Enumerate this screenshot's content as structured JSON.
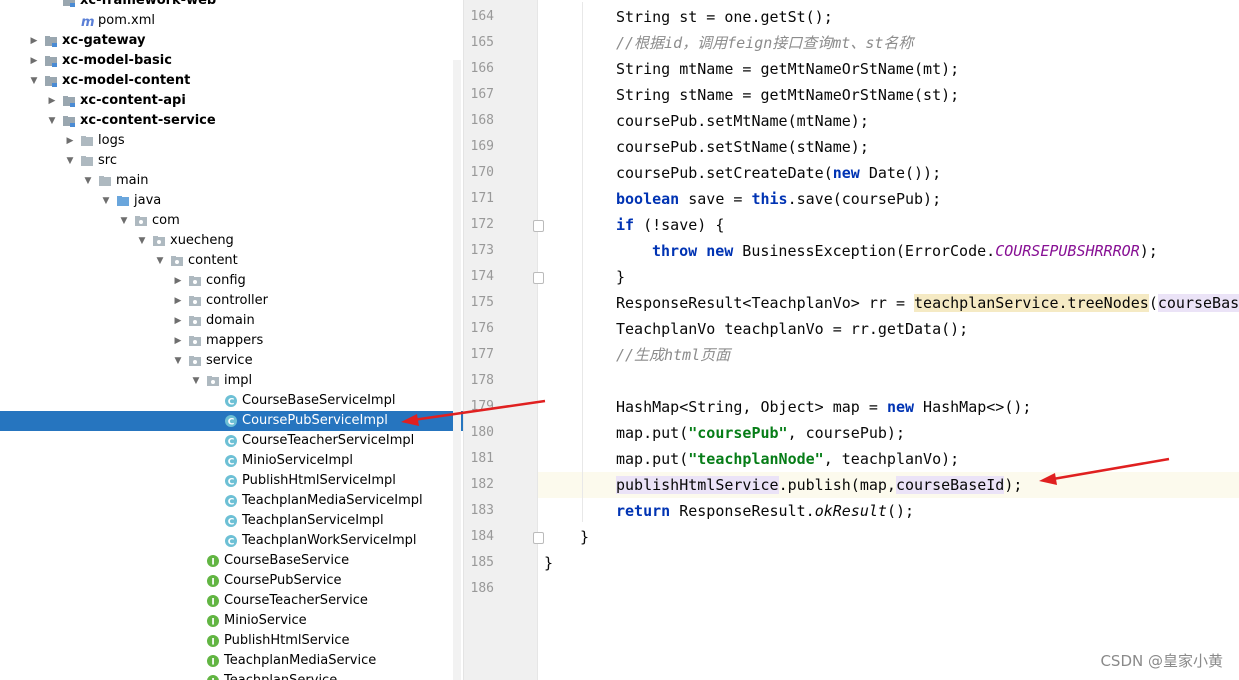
{
  "project_tree": {
    "rows": [
      {
        "label": "xc-framework-web",
        "indent": 1,
        "arrow": "none",
        "icon": "module",
        "bold": true
      },
      {
        "label": "pom.xml",
        "indent": 2,
        "arrow": "none",
        "icon": "maven",
        "bold": false
      },
      {
        "label": "xc-gateway",
        "indent": 0,
        "arrow": "right",
        "icon": "module",
        "bold": true
      },
      {
        "label": "xc-model-basic",
        "indent": 0,
        "arrow": "right",
        "icon": "module",
        "bold": true
      },
      {
        "label": "xc-model-content",
        "indent": 0,
        "arrow": "down",
        "icon": "module",
        "bold": true
      },
      {
        "label": "xc-content-api",
        "indent": 1,
        "arrow": "right",
        "icon": "module",
        "bold": true
      },
      {
        "label": "xc-content-service",
        "indent": 1,
        "arrow": "down",
        "icon": "module",
        "bold": true
      },
      {
        "label": "logs",
        "indent": 2,
        "arrow": "right",
        "icon": "folder",
        "bold": false
      },
      {
        "label": "src",
        "indent": 2,
        "arrow": "down",
        "icon": "folder",
        "bold": false
      },
      {
        "label": "main",
        "indent": 3,
        "arrow": "down",
        "icon": "folder",
        "bold": false
      },
      {
        "label": "java",
        "indent": 4,
        "arrow": "down",
        "icon": "folder-blue",
        "bold": false
      },
      {
        "label": "com",
        "indent": 5,
        "arrow": "down",
        "icon": "package",
        "bold": false
      },
      {
        "label": "xuecheng",
        "indent": 6,
        "arrow": "down",
        "icon": "package",
        "bold": false
      },
      {
        "label": "content",
        "indent": 7,
        "arrow": "down",
        "icon": "package",
        "bold": false
      },
      {
        "label": "config",
        "indent": 8,
        "arrow": "right",
        "icon": "package",
        "bold": false
      },
      {
        "label": "controller",
        "indent": 8,
        "arrow": "right",
        "icon": "package",
        "bold": false
      },
      {
        "label": "domain",
        "indent": 8,
        "arrow": "right",
        "icon": "package",
        "bold": false
      },
      {
        "label": "mappers",
        "indent": 8,
        "arrow": "right",
        "icon": "package",
        "bold": false
      },
      {
        "label": "service",
        "indent": 8,
        "arrow": "down",
        "icon": "package",
        "bold": false
      },
      {
        "label": "impl",
        "indent": 9,
        "arrow": "down",
        "icon": "package",
        "bold": false
      },
      {
        "label": "CourseBaseServiceImpl",
        "indent": 10,
        "arrow": "none",
        "icon": "class",
        "bold": false
      },
      {
        "label": "CoursePubServiceImpl",
        "indent": 10,
        "arrow": "none",
        "icon": "class",
        "bold": false,
        "selected": true
      },
      {
        "label": "CourseTeacherServiceImpl",
        "indent": 10,
        "arrow": "none",
        "icon": "class",
        "bold": false
      },
      {
        "label": "MinioServiceImpl",
        "indent": 10,
        "arrow": "none",
        "icon": "class",
        "bold": false
      },
      {
        "label": "PublishHtmlServiceImpl",
        "indent": 10,
        "arrow": "none",
        "icon": "class",
        "bold": false
      },
      {
        "label": "TeachplanMediaServiceImpl",
        "indent": 10,
        "arrow": "none",
        "icon": "class",
        "bold": false
      },
      {
        "label": "TeachplanServiceImpl",
        "indent": 10,
        "arrow": "none",
        "icon": "class",
        "bold": false
      },
      {
        "label": "TeachplanWorkServiceImpl",
        "indent": 10,
        "arrow": "none",
        "icon": "class",
        "bold": false
      },
      {
        "label": "CourseBaseService",
        "indent": 9,
        "arrow": "none",
        "icon": "interface",
        "bold": false
      },
      {
        "label": "CoursePubService",
        "indent": 9,
        "arrow": "none",
        "icon": "interface",
        "bold": false
      },
      {
        "label": "CourseTeacherService",
        "indent": 9,
        "arrow": "none",
        "icon": "interface",
        "bold": false
      },
      {
        "label": "MinioService",
        "indent": 9,
        "arrow": "none",
        "icon": "interface",
        "bold": false
      },
      {
        "label": "PublishHtmlService",
        "indent": 9,
        "arrow": "none",
        "icon": "interface",
        "bold": false
      },
      {
        "label": "TeachplanMediaService",
        "indent": 9,
        "arrow": "none",
        "icon": "interface",
        "bold": false
      },
      {
        "label": "TeachplanService",
        "indent": 9,
        "arrow": "none",
        "icon": "interface",
        "bold": false
      }
    ]
  },
  "editor": {
    "current_line": "182",
    "lines": [
      {
        "num": "164",
        "indent": 2,
        "fold": false,
        "tokens": [
          [
            "String st = one.getSt();",
            ""
          ]
        ]
      },
      {
        "num": "165",
        "indent": 2,
        "fold": false,
        "tokens": [
          [
            "//根据id，调用feign接口查询mt、st名称",
            "cmt"
          ]
        ]
      },
      {
        "num": "166",
        "indent": 2,
        "fold": false,
        "tokens": [
          [
            "String mtName = getMtNameOrStName(mt);",
            ""
          ]
        ]
      },
      {
        "num": "167",
        "indent": 2,
        "fold": false,
        "tokens": [
          [
            "String stName = getMtNameOrStName(st);",
            ""
          ]
        ]
      },
      {
        "num": "168",
        "indent": 2,
        "fold": false,
        "tokens": [
          [
            "coursePub.setMtName(mtName);",
            ""
          ]
        ]
      },
      {
        "num": "169",
        "indent": 2,
        "fold": false,
        "tokens": [
          [
            "coursePub.setStName(stName);",
            ""
          ]
        ]
      },
      {
        "num": "170",
        "indent": 2,
        "fold": false,
        "tokens": [
          [
            "coursePub.setCreateDate(",
            ""
          ],
          [
            "new",
            "kw"
          ],
          [
            " Date());",
            ""
          ]
        ]
      },
      {
        "num": "171",
        "indent": 2,
        "fold": false,
        "tokens": [
          [
            "boolean",
            "kw"
          ],
          [
            " save = ",
            ""
          ],
          [
            "this",
            "kw"
          ],
          [
            ".save(coursePub);",
            ""
          ]
        ]
      },
      {
        "num": "172",
        "indent": 2,
        "fold": true,
        "tokens": [
          [
            "if",
            "kw"
          ],
          [
            " (!save) {",
            ""
          ]
        ]
      },
      {
        "num": "173",
        "indent": 3,
        "fold": false,
        "tokens": [
          [
            "throw",
            "kw"
          ],
          [
            " ",
            ""
          ],
          [
            "new",
            "kw"
          ],
          [
            " BusinessException(ErrorCode.",
            ""
          ],
          [
            "COURSEPUBSHRRROR",
            "cst"
          ],
          [
            ");",
            ""
          ]
        ]
      },
      {
        "num": "174",
        "indent": 2,
        "fold": true,
        "tokens": [
          [
            "}",
            ""
          ]
        ]
      },
      {
        "num": "175",
        "indent": 2,
        "fold": false,
        "tokens": [
          [
            "ResponseResult<TeachplanVo> rr = ",
            ""
          ],
          [
            "teachplanService",
            "hl-y"
          ],
          [
            ".treeNodes",
            "hl-y"
          ],
          [
            "(",
            ""
          ],
          [
            "courseBase",
            "hl-p"
          ]
        ]
      },
      {
        "num": "176",
        "indent": 2,
        "fold": false,
        "tokens": [
          [
            "TeachplanVo teachplanVo = rr.getData();",
            ""
          ]
        ]
      },
      {
        "num": "177",
        "indent": 2,
        "fold": false,
        "tokens": [
          [
            "//生成html页面",
            "cmt"
          ]
        ]
      },
      {
        "num": "178",
        "indent": 2,
        "fold": false,
        "tokens": []
      },
      {
        "num": "179",
        "indent": 2,
        "fold": false,
        "tokens": [
          [
            "HashMap<String, Object> map = ",
            ""
          ],
          [
            "new",
            "kw"
          ],
          [
            " HashMap<>();",
            ""
          ]
        ]
      },
      {
        "num": "180",
        "indent": 2,
        "fold": false,
        "tokens": [
          [
            "map.put(",
            ""
          ],
          [
            "\"coursePub\"",
            "str"
          ],
          [
            ", coursePub);",
            ""
          ]
        ]
      },
      {
        "num": "181",
        "indent": 2,
        "fold": false,
        "tokens": [
          [
            "map.put(",
            ""
          ],
          [
            "\"teachplanNode\"",
            "str"
          ],
          [
            ", teachplanVo);",
            ""
          ]
        ]
      },
      {
        "num": "182",
        "indent": 2,
        "fold": false,
        "tokens": [
          [
            "publishHtmlService",
            "hl-p"
          ],
          [
            ".publish(map,",
            ""
          ],
          [
            "courseBaseId",
            "hl-p"
          ],
          [
            ");",
            ""
          ]
        ]
      },
      {
        "num": "183",
        "indent": 2,
        "fold": false,
        "tokens": [
          [
            "return",
            "kw"
          ],
          [
            " ResponseResult.",
            ""
          ],
          [
            "okResult",
            "ital"
          ],
          [
            "();",
            ""
          ]
        ]
      },
      {
        "num": "184",
        "indent": 1,
        "fold": true,
        "tokens": [
          [
            "}",
            ""
          ]
        ]
      },
      {
        "num": "185",
        "indent": 0,
        "fold": false,
        "tokens": [
          [
            "}",
            ""
          ]
        ]
      },
      {
        "num": "186",
        "indent": 0,
        "fold": false,
        "tokens": []
      }
    ]
  },
  "watermark": "CSDN @皇家小黄",
  "colors": {
    "selection": "#2675bf",
    "arrow": "#e02020",
    "keyword": "#0033b3",
    "string": "#067d17",
    "comment": "#8c8c8c"
  }
}
